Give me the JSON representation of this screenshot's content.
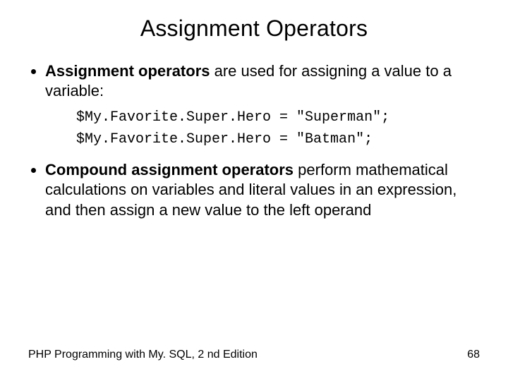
{
  "title": "Assignment Operators",
  "bullets": [
    {
      "bold": "Assignment operators",
      "rest": " are used for assigning a value to a variable:"
    },
    {
      "bold": "Compound assignment operators",
      "rest": " perform mathematical calculations on variables and literal values in an expression, and then assign a new value to the left operand"
    }
  ],
  "code_lines": [
    "$My.Favorite.Super.Hero = \"Superman\";",
    "$My.Favorite.Super.Hero = \"Batman\";"
  ],
  "footer": {
    "book": "PHP Programming with My. SQL, 2 nd Edition",
    "page": "68"
  }
}
